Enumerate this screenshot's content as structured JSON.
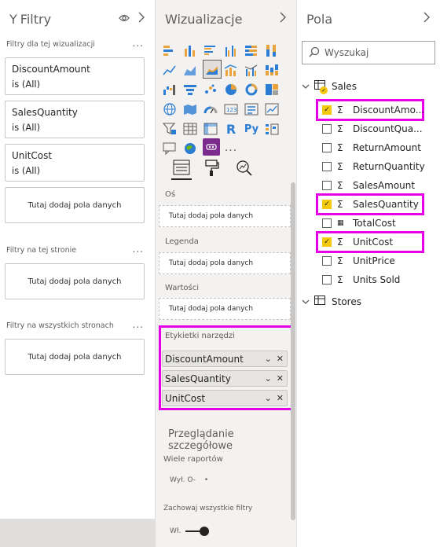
{
  "filters_pane": {
    "title": "Filtry",
    "visual_section_title": "Filtry dla tej wizualizacji",
    "visual_filters": [
      {
        "name": "DiscountAmount",
        "value": "is (All)"
      },
      {
        "name": "SalesQuantity",
        "value": "is (All)"
      },
      {
        "name": "UnitCost",
        "value": "is (All)"
      }
    ],
    "add_fields_text": "Tutaj dodaj pola danych",
    "page_section_title": "Filtry na tej stronie",
    "all_pages_section_title": "Filtry na wszystkich stronach",
    "more": "..."
  },
  "viz_pane": {
    "title": "Wizualizacje",
    "more_visuals": "...",
    "wells": {
      "axis_label": "Oś",
      "legend_label": "Legenda",
      "values_label": "Wartości",
      "tooltips_label": "Etykietki narzędzi",
      "drop_text": "Tutaj dodaj pola danych"
    },
    "tooltip_fields": [
      "DiscountAmount",
      "SalesQuantity",
      "UnitCost"
    ],
    "drillthrough_title": "Przeglądanie szczegółowe",
    "cross_report_label": "Wiele raportów",
    "cross_report_toggle_text": "Wył. O-",
    "keep_filters_label": "Zachowaj wszystkie filtry",
    "keep_filters_toggle_text": "Wł."
  },
  "fields_pane": {
    "title": "Pola",
    "search_placeholder": "Wyszukaj",
    "tables": [
      {
        "name": "Sales",
        "expanded": true,
        "fields": [
          {
            "name": "DiscountAmo...",
            "checked": true,
            "sigma": true
          },
          {
            "name": "DiscountQua...",
            "checked": false,
            "sigma": true
          },
          {
            "name": "ReturnAmount",
            "checked": false,
            "sigma": true
          },
          {
            "name": "ReturnQuantity",
            "checked": false,
            "sigma": true
          },
          {
            "name": "SalesAmount",
            "checked": false,
            "sigma": true
          },
          {
            "name": "SalesQuantity",
            "checked": true,
            "sigma": true
          },
          {
            "name": "TotalCost",
            "checked": false,
            "sigma": false
          },
          {
            "name": "UnitCost",
            "checked": true,
            "sigma": true
          },
          {
            "name": "UnitPrice",
            "checked": false,
            "sigma": true
          },
          {
            "name": "Units Sold",
            "checked": false,
            "sigma": true
          }
        ]
      },
      {
        "name": "Stores",
        "expanded": false,
        "fields": []
      }
    ]
  },
  "colors": {
    "highlight": "#e600e6",
    "checkbox_checked": "#f2c811",
    "pane_bg": "#f3f2f1"
  }
}
